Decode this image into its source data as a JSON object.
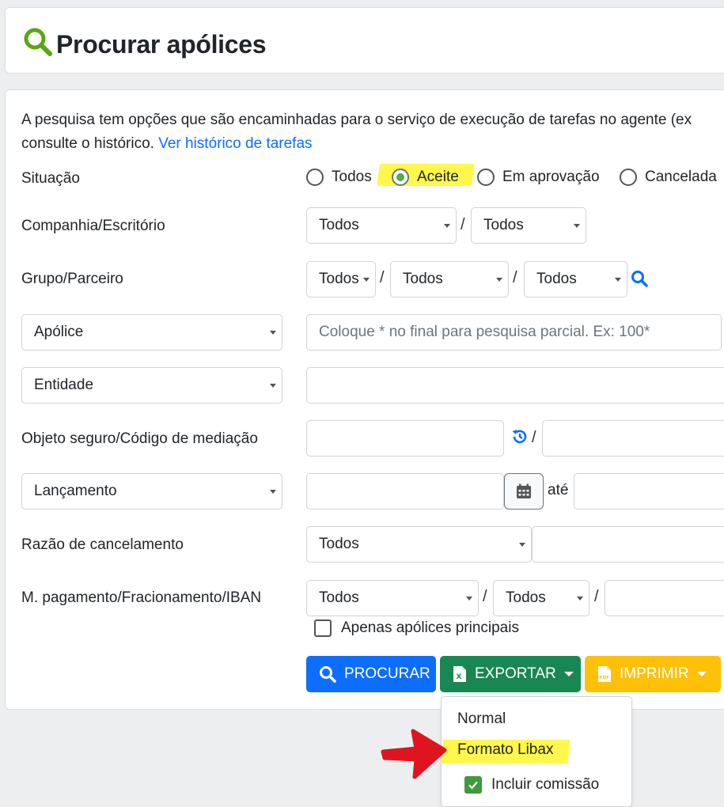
{
  "header": {
    "title": "Procurar apólices",
    "icon": "search-icon"
  },
  "info": {
    "text": "A pesquisa tem opções que são encaminhadas para o serviço de execução de tarefas no agente (ex",
    "text2": "consulte o histórico.",
    "link": "Ver histórico de tarefas"
  },
  "situacao": {
    "label": "Situação",
    "options": [
      "Todos",
      "Aceite",
      "Em aprovação",
      "Cancelada"
    ],
    "selected": "Aceite"
  },
  "companhia": {
    "label": "Companhia/Escritório",
    "values": [
      "Todos",
      "Todos"
    ]
  },
  "grupo": {
    "label": "Grupo/Parceiro",
    "values": [
      "Todos",
      "Todos",
      "Todos"
    ]
  },
  "apolice": {
    "select": "Apólice",
    "placeholder": "Coloque * no final para pesquisa parcial. Ex: 100*"
  },
  "entidade": {
    "select": "Entidade"
  },
  "objeto": {
    "label": "Objeto seguro/Código de mediação"
  },
  "lancamento": {
    "select": "Lançamento",
    "ate": "até"
  },
  "razao": {
    "label": "Razão de cancelamento",
    "value": "Todos"
  },
  "pagamento": {
    "label": "M. pagamento/Fracionamento/IBAN",
    "values": [
      "Todos",
      "Todos"
    ]
  },
  "apenas": {
    "label": "Apenas apólices principais",
    "checked": false
  },
  "buttons": {
    "procurar": "PROCURAR",
    "exportar": "EXPORTAR",
    "imprimir": "IMPRIMIR"
  },
  "export_menu": {
    "items": [
      "Normal",
      "Formato Libax"
    ],
    "checkbox": {
      "label": "Incluir comissão",
      "checked": true
    }
  },
  "colors": {
    "primary": "#0d6efd",
    "success": "#198754",
    "warning": "#ffc107",
    "highlight": "#fff74d",
    "annotation_arrow": "#e0141e"
  }
}
